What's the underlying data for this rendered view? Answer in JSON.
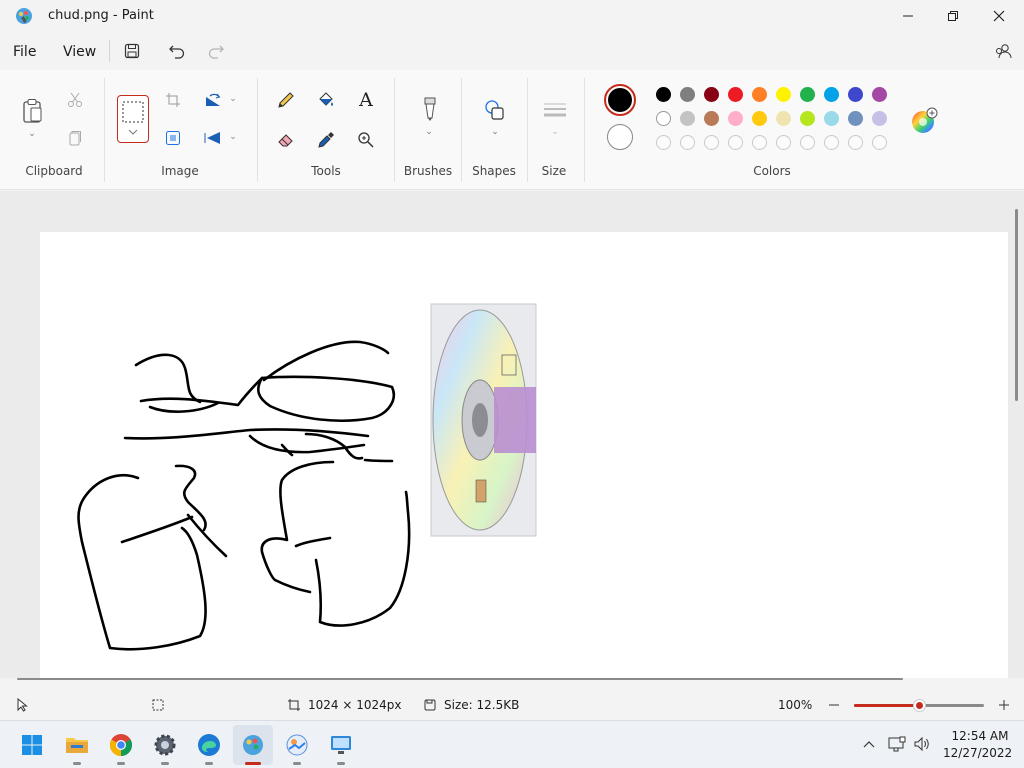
{
  "window": {
    "title": "chud.png - Paint"
  },
  "menu": {
    "file": "File",
    "view": "View"
  },
  "ribbon": {
    "groups": {
      "clipboard": "Clipboard",
      "image": "Image",
      "tools": "Tools",
      "brushes": "Brushes",
      "shapes": "Shapes",
      "size": "Size",
      "colors": "Colors"
    },
    "text_tool_glyph": "A"
  },
  "colors": {
    "primary": "#000000",
    "secondary": "#ffffff",
    "row1": [
      "#000000",
      "#7f7f7f",
      "#880015",
      "#ed1c24",
      "#ff7f27",
      "#fff200",
      "#22b14c",
      "#00a2e8",
      "#3f48cc",
      "#a349a4"
    ],
    "row2": [
      "#ffffff",
      "#c3c3c3",
      "#b97a57",
      "#ffaec9",
      "#ffc90e",
      "#efe4b0",
      "#b5e61d",
      "#99d9ea",
      "#7092be",
      "#c8bfe7"
    ],
    "row3_count": 10
  },
  "status": {
    "dimensions": "1024 × 1024px",
    "size": "Size: 12.5KB",
    "zoom": "100%",
    "zoom_level": 0.5
  },
  "taskbar": {
    "time": "12:54 AM",
    "date": "12/27/2022"
  },
  "accent": "#c42b1c"
}
